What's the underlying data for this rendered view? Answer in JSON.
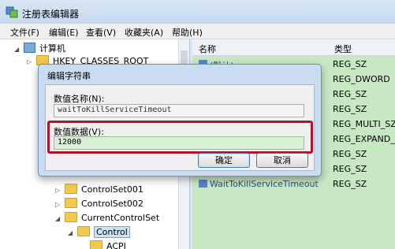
{
  "window": {
    "title": "注册表编辑器"
  },
  "menu": [
    "文件(F)",
    "编辑(E)",
    "查看(V)",
    "收藏夹(A)",
    "帮助(H)"
  ],
  "tree": {
    "computer": "计算机",
    "hklm_root": "HKEY_CLASSES_ROOT",
    "cs001": "ControlSet001",
    "cs002": "ControlSet002",
    "ccs": "CurrentControlSet",
    "control": "Control",
    "acpi": "ACPI"
  },
  "list": {
    "col_name": "名称",
    "col_type": "类型",
    "rows": [
      {
        "name": "(默认)",
        "type": "REG_SZ"
      },
      {
        "name": "",
        "type": "REG_DWORD"
      },
      {
        "name": "",
        "type": "REG_SZ"
      },
      {
        "name": "",
        "type": "REG_SZ"
      },
      {
        "name": "",
        "type": "REG_MULTI_SZ"
      },
      {
        "name": "",
        "type": "REG_EXPAND_SZ"
      },
      {
        "name": "",
        "type": "REG_SZ"
      },
      {
        "name": "",
        "type": "REG_SZ"
      },
      {
        "name": "WaitToKillServiceTimeout",
        "type": "REG_SZ"
      }
    ]
  },
  "dialog": {
    "title": "编辑字符串",
    "name_label": "数值名称(N):",
    "name_value": "waitToKillServiceTimeout",
    "data_label": "数值数据(V):",
    "data_value": "12000",
    "ok": "确定",
    "cancel": "取消"
  },
  "colors": {
    "highlight": "#b0132b",
    "list_bg": "#c8e8c4"
  }
}
